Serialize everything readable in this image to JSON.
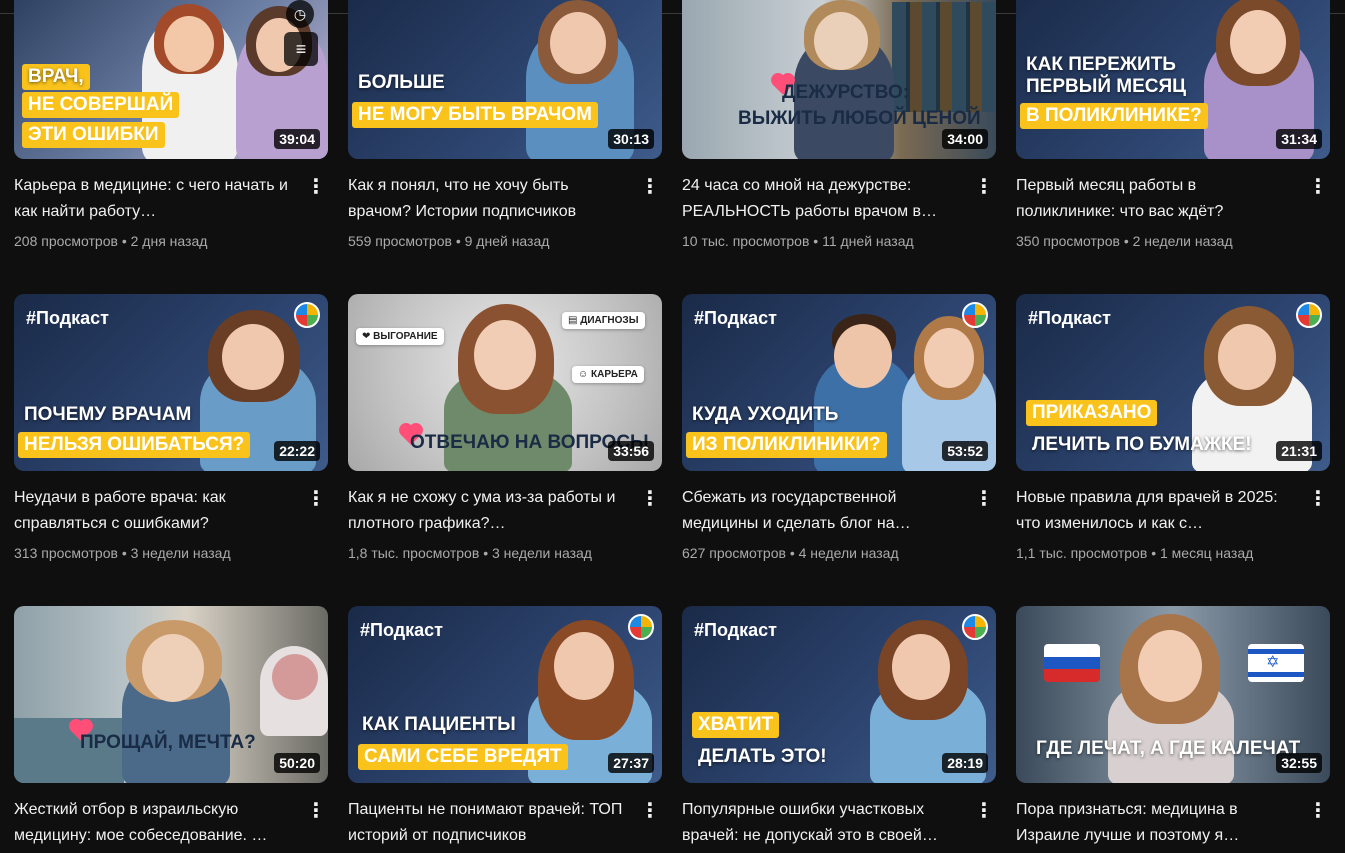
{
  "videos": [
    {
      "title": "Карьера в медицине: с чего начать и как найти работу…",
      "views": "208 просмотров",
      "age": "2 дня назад",
      "duration": "39:04",
      "captions": [
        "ВРАЧ,",
        "НЕ СОВЕРШАЙ",
        "ЭТИ ОШИБКИ"
      ]
    },
    {
      "title": "Как я понял, что не хочу быть врачом? Истории подписчиков",
      "views": "559 просмотров",
      "age": "9 дней назад",
      "duration": "30:13",
      "captions": [
        "БОЛЬШЕ",
        "НЕ МОГУ БЫТЬ ВРАЧОМ"
      ]
    },
    {
      "title": "24 часа со мной на дежурстве: РЕАЛЬНОСТЬ работы врачом в…",
      "views": "10 тыс. просмотров",
      "age": "11 дней назад",
      "duration": "34:00",
      "captions": [
        "ДЕЖУРСТВО:",
        "ВЫЖИТЬ ЛЮБОЙ ЦЕНОЙ"
      ]
    },
    {
      "title": "Первый месяц работы в поликлинике: что вас ждёт?",
      "views": "350 просмотров",
      "age": "2 недели назад",
      "duration": "31:34",
      "captions": [
        "КАК ПЕРЕЖИТЬ",
        "ПЕРВЫЙ МЕСЯЦ",
        "В ПОЛИКЛИНИКЕ?"
      ]
    },
    {
      "title": "Неудачи в работе врача: как справляться с ошибками?",
      "views": "313 просмотров",
      "age": "3 недели назад",
      "duration": "22:22",
      "podcast": "#Подкаст",
      "captions": [
        "ПОЧЕМУ ВРАЧАМ",
        "НЕЛЬЗЯ ОШИБАТЬСЯ?"
      ]
    },
    {
      "title": "Как я не схожу с ума из-за работы и плотного графика?…",
      "views": "1,8 тыс. просмотров",
      "age": "3 недели назад",
      "duration": "33:56",
      "captions": [
        "ОТВЕЧАЮ НА ВОПРОСЫ"
      ],
      "chips": [
        "ВЫГОРАНИЕ",
        "ДИАГНОЗЫ",
        "КАРЬЕРА"
      ]
    },
    {
      "title": "Сбежать из государственной медицины и сделать блог на…",
      "views": "627 просмотров",
      "age": "4 недели назад",
      "duration": "53:52",
      "podcast": "#Подкаст",
      "captions": [
        "КУДА УХОДИТЬ",
        "ИЗ ПОЛИКЛИНИКИ?"
      ]
    },
    {
      "title": "Новые правила для врачей в 2025: что изменилось и как с…",
      "views": "1,1 тыс. просмотров",
      "age": "1 месяц назад",
      "duration": "21:31",
      "podcast": "#Подкаст",
      "captions": [
        "ПРИКАЗАНО",
        "ЛЕЧИТЬ ПО БУМАЖКЕ!"
      ]
    },
    {
      "title": "Жесткий отбор в израильскую медицину: мое собеседование. …",
      "views": "",
      "age": "",
      "duration": "50:20",
      "captions": [
        "ПРОЩАЙ, МЕЧТА?"
      ]
    },
    {
      "title": "Пациенты не понимают врачей: ТОП историй от подписчиков",
      "views": "",
      "age": "",
      "duration": "27:37",
      "podcast": "#Подкаст",
      "captions": [
        "КАК ПАЦИЕНТЫ",
        "САМИ СЕБЕ ВРЕДЯТ"
      ]
    },
    {
      "title": "Популярные ошибки участковых врачей: не допускай это в своей…",
      "views": "",
      "age": "",
      "duration": "28:19",
      "podcast": "#Подкаст",
      "captions": [
        "ХВАТИТ",
        "ДЕЛАТЬ ЭТО!"
      ]
    },
    {
      "title": "Пора признаться: медицина в Израиле лучше и поэтому я…",
      "views": "",
      "age": "",
      "duration": "32:55",
      "captions": [
        "ГДЕ ЛЕЧАТ, А ГДЕ КАЛЕЧАТ"
      ]
    }
  ],
  "separator": "•",
  "menu_glyph": "⋮",
  "colors": {
    "background": "#0f0f0f",
    "caption_yellow": "#f9c31c",
    "navy_bg": "#1c2d4a",
    "heart": "#ff4f78"
  },
  "icons": [
    "watch-later-icon",
    "add-to-queue-icon",
    "more-vert-icon",
    "brain-logo-icon",
    "heart-icon",
    "russia-flag-icon",
    "israel-flag-icon"
  ]
}
